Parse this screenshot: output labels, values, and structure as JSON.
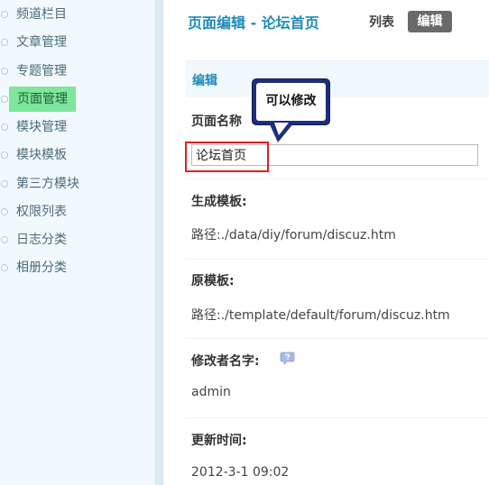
{
  "sidebar": {
    "items": [
      {
        "label": "频道栏目"
      },
      {
        "label": "文章管理"
      },
      {
        "label": "专题管理"
      },
      {
        "label": "页面管理"
      },
      {
        "label": "模块管理"
      },
      {
        "label": "模块模板"
      },
      {
        "label": "第三方模块"
      },
      {
        "label": "权限列表"
      },
      {
        "label": "日志分类"
      },
      {
        "label": "相册分类"
      }
    ],
    "active_index": 3
  },
  "header": {
    "title": "页面编辑 - 论坛首页",
    "tabs": [
      {
        "label": "列表"
      },
      {
        "label": "编辑"
      }
    ]
  },
  "section": {
    "title": "编辑"
  },
  "fields": {
    "page_name_label": "页面名称",
    "page_name_value": "论坛首页",
    "generated_template_label": "生成模板:",
    "generated_template_value": "路径:./data/diy/forum/discuz.htm",
    "original_template_label": "原模板:",
    "original_template_value": "路径:./template/default/forum/discuz.htm",
    "modifier_label": "修改者名字:",
    "modifier_value": "admin",
    "updated_label": "更新时间:",
    "updated_value": "2012-3-1 09:02"
  },
  "callout": {
    "text": "可以修改"
  },
  "colors": {
    "accent": "#1e8bb8",
    "active_item": "#7ee69c",
    "callout_border": "#1d2f7a",
    "highlight": "#e02020"
  },
  "icons": {
    "help": "help-bubble-icon"
  }
}
